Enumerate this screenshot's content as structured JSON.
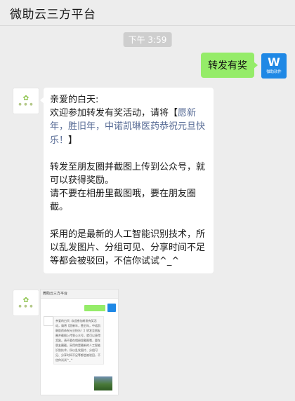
{
  "header": {
    "title": "微助云三方平台"
  },
  "timestamp": "下午 3:59",
  "messages": {
    "outgoing": {
      "text": "转发有奖",
      "avatar_label": "微助软件",
      "avatar_letter": "W"
    },
    "incoming": {
      "line_greeting": "亲爱的白天:",
      "line_invite_prefix": "欢迎参加转发有奖活动，请将【",
      "line_invite_highlight": "愿新年，胜旧年，中诺凯琳医药恭祝元旦快乐！",
      "line_invite_suffix": "】",
      "line_share": "转发至朋友圈并截图上传到公众号，就可以获得奖励。",
      "line_warning": "请不要在相册里截图哦，要在朋友圈截。",
      "line_ai": "采用的是最新的人工智能识别技术，所以乱发图片、分组可见、分享时间不足等都会被驳回，不信你试试^_^"
    },
    "image_thumb": {
      "mini_title": "微助云三方平台",
      "mini_text": "亲爱的白天: 欢迎参加转发有奖活动，请将【愿新年，胜旧年，中诺凯琳医药恭祝元旦快乐！】转发至朋友圈并截图上传到公众号，就可以获得奖励。请不要在相册里截图哦，要在朋友圈截。采用的是最新的人工智能识别技术，所以乱发图片、分组可见、分享时间不足等都会被驳回，不信你试试^_^"
    }
  },
  "colors": {
    "background": "#ededed",
    "outgoing_bubble": "#95ec69",
    "incoming_bubble": "#ffffff",
    "link_highlight": "#576b95",
    "brand_avatar": "#1f88e5"
  }
}
